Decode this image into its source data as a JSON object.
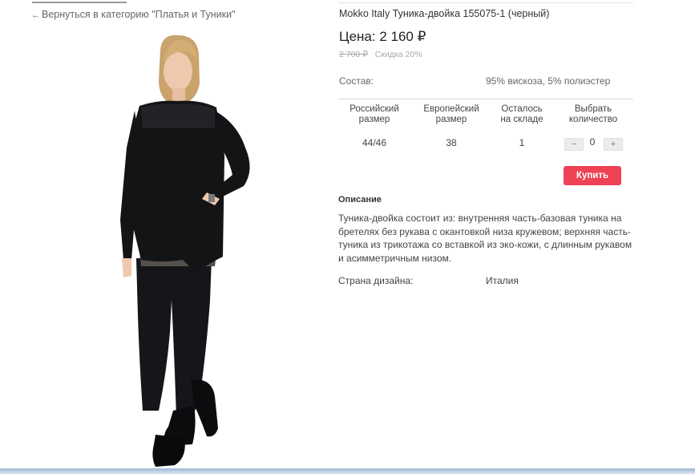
{
  "nav": {
    "back_arrow_icon": "arrow-left-icon",
    "back_link": "Вернуться в категорию \"Платья и Туники\""
  },
  "product": {
    "title": "Mokko Italy Туника-двойка 155075-1 (черный)",
    "price": "Цена: 2 160 ₽",
    "old_price": "2 700 ₽",
    "discount": "Скидка 20%",
    "composition_label": "Состав:",
    "composition_value": "95% вискоза, 5% полиэстер"
  },
  "size_table": {
    "headers": [
      {
        "line1": "Российский",
        "line2": "размер"
      },
      {
        "line1": "Европейский",
        "line2": "размер"
      },
      {
        "line1": "Осталось",
        "line2": "на складе"
      },
      {
        "line1": "Выбрать",
        "line2": "количество"
      }
    ],
    "row": {
      "ru_size": "44/46",
      "eu_size": "38",
      "stock": "1",
      "quantity": "0"
    },
    "minus": "−",
    "plus": "+"
  },
  "buy_button": "Купить",
  "description": {
    "title": "Описание",
    "text": "Туника-двойка состоит из: внутренняя часть-базовая туника на бретелях без рукава с окантовкой низа кружевом; верхняя часть-туника из трикотажа со вставкой из эко-кожи, с длинным рукавом и асимметричным низом."
  },
  "design_country": {
    "label": "Страна дизайна:",
    "value": "Италия"
  },
  "colors": {
    "buy_button": "#ef4255",
    "garment": "#141416",
    "text": "#444444",
    "muted": "#aaaaaa"
  }
}
